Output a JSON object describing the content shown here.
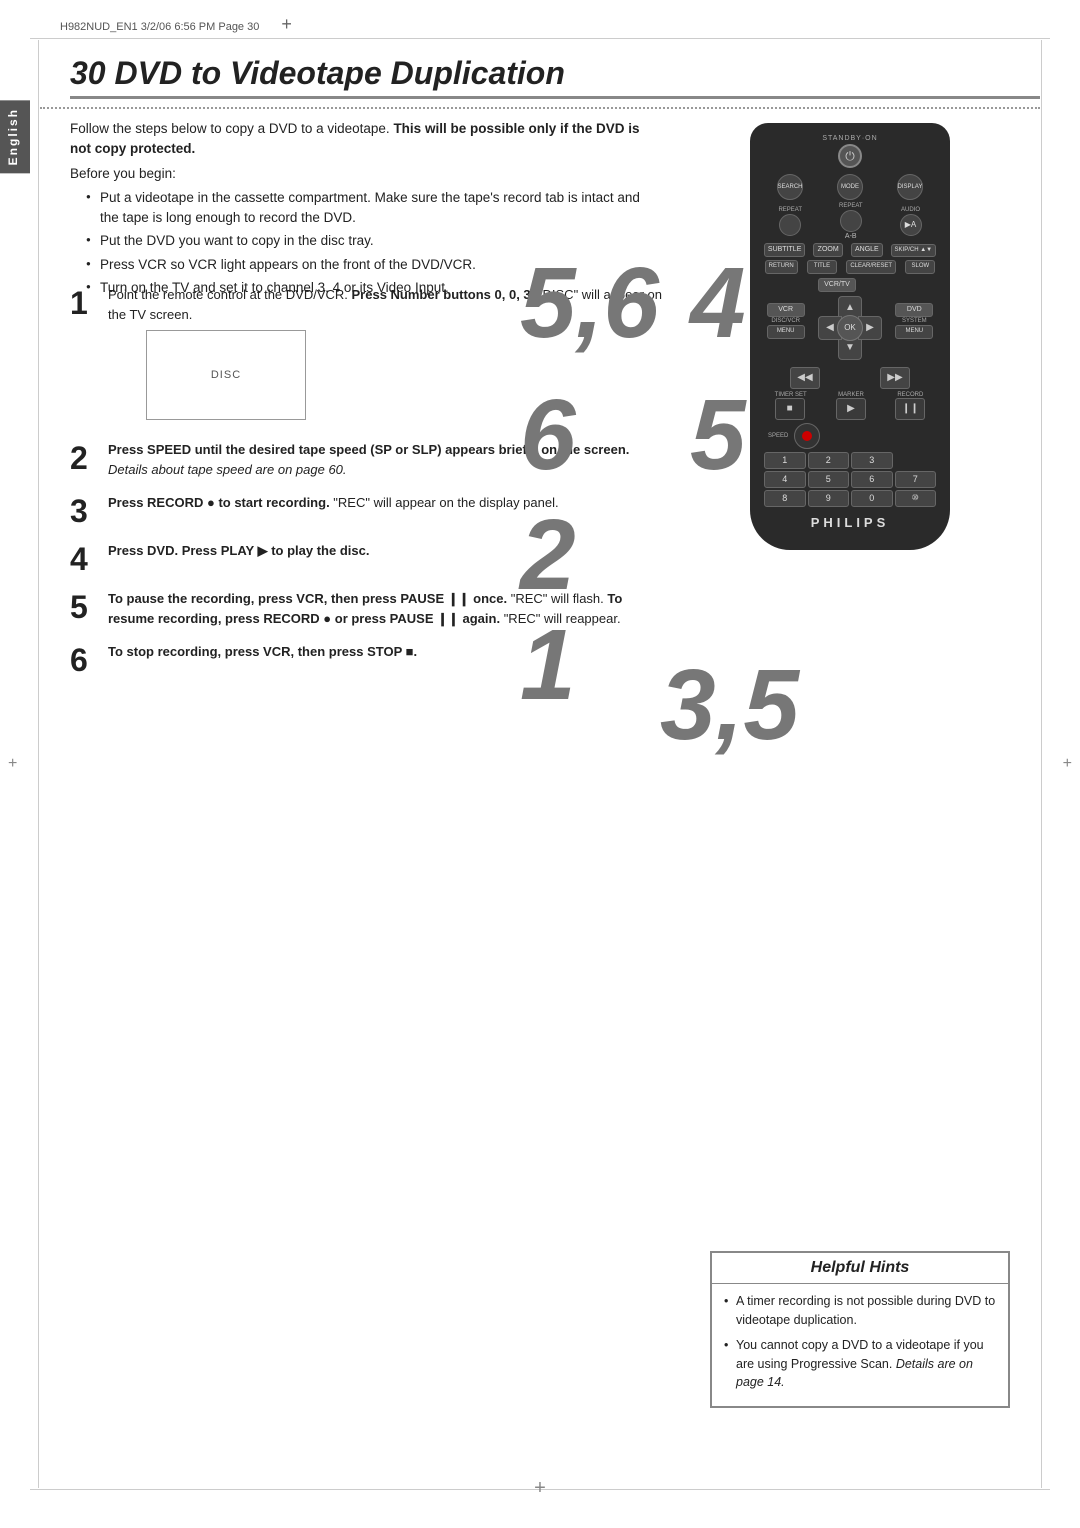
{
  "page": {
    "header": "H982NUD_EN1  3/2/06  6:56 PM  Page 30",
    "chapter_number": "30",
    "chapter_title": "DVD to Videotape Duplication",
    "language_tab": "English"
  },
  "intro": {
    "line1": "Follow the steps below to copy a DVD to a videotape.",
    "line1_bold": "This will",
    "line2_bold": "be possible only if the DVD is not copy protected.",
    "before_begin": "Before you begin:",
    "bullets": [
      "Put a videotape in the cassette compartment. Make sure the tape's record tab is intact and the tape is long enough to record the DVD.",
      "Put the DVD you want to copy in the disc tray.",
      "Press VCR so VCR light appears on the front of the DVD/VCR.",
      "Turn on the TV and set it to channel 3, 4 or its Video Input."
    ]
  },
  "steps": [
    {
      "num": "1",
      "text": "Point the remote control at the DVD/VCR. Press Number buttons 0, 0, 3. \"DISC\" will appear on the TV screen.",
      "has_disc_box": true,
      "disc_label": "DISC"
    },
    {
      "num": "2",
      "text": "Press SPEED until the desired tape speed (SP or SLP) appears briefly on the screen. Details about tape speed are on page 60."
    },
    {
      "num": "3",
      "text": "Press RECORD ● to start recording. \"REC\" will appear on the display panel."
    },
    {
      "num": "4",
      "text": "Press DVD.  Press PLAY ▶ to play the disc."
    },
    {
      "num": "5",
      "text": "To pause the recording, press VCR, then press PAUSE ❙❙ once. \"REC\" will flash. To resume recording, press RECORD ● or press PAUSE ❙❙ again. \"REC\" will reappear."
    },
    {
      "num": "6",
      "text": "To stop recording, press VCR, then press STOP ■."
    }
  ],
  "overlay_numbers": {
    "top": "5,6",
    "mid_left": "6",
    "mid_right": "4",
    "lower_left": "2",
    "lower_right": "5",
    "bottom_left": "1",
    "bottom_right": "3,5"
  },
  "remote": {
    "standby_label": "STANDBY·ON",
    "rows": [
      [
        "SEARCH",
        "MODE",
        "DISPLAY"
      ],
      [
        "REPEAT",
        "REPEAT",
        "AUDIO"
      ],
      [
        "A-B",
        "",
        "▶A"
      ],
      [
        "SUBTITLE",
        "ZOOM",
        "ANGLE",
        "SKIP/CH"
      ],
      [
        "RETURN",
        "TITLE",
        "CLEAR/RESET",
        "SLOW"
      ]
    ],
    "mode_btns": [
      "VCR",
      "VCR/TV",
      "DVD"
    ],
    "disc_vcr": "DISC/VCR",
    "system_menu": "SYSTEM\nMENU",
    "nav": {
      "up": "▲",
      "down": "▼",
      "left": "◀",
      "right": "▶",
      "ok": "OK"
    },
    "transport": {
      "rewind": "◀◀",
      "ffwd": "▶▶",
      "stop": "■",
      "play": "▶",
      "pause": "❙❙"
    },
    "bottom_labels": [
      "TIMER SET",
      "MARKER",
      "RECORD"
    ],
    "speed_label": "SPEED",
    "numpad": [
      "1",
      "2",
      "3",
      "4",
      "5",
      "6",
      "7",
      "8",
      "9",
      "0",
      "10"
    ],
    "logo": "PHILIPS"
  },
  "hints": {
    "title": "Helpful Hints",
    "items": [
      "A timer recording is not possible during DVD to videotape duplication.",
      "You cannot copy a DVD to a videotape if you are using Progressive Scan. Details are on page 14."
    ]
  }
}
